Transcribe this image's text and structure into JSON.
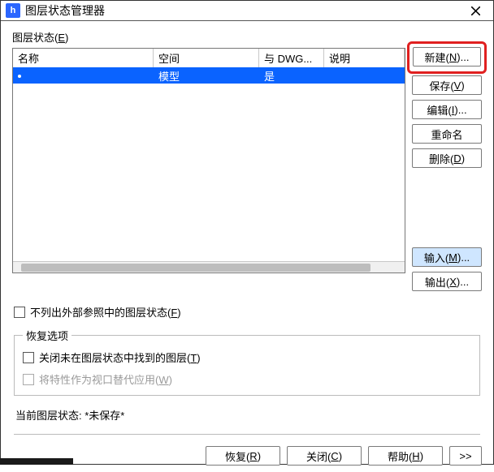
{
  "titlebar": {
    "icon_text": "h",
    "title": "图层状态管理器"
  },
  "states_label": "图层状态(E)",
  "table": {
    "headers": {
      "name": "名称",
      "space": "空间",
      "dwg": "与 DWG...",
      "desc": "说明"
    },
    "rows": [
      {
        "name": "",
        "space": "模型",
        "dwg": "是",
        "desc": "",
        "selected": true
      }
    ]
  },
  "side_buttons": {
    "new": "新建(N)...",
    "save": "保存(V)",
    "edit": "编辑(I)...",
    "rename": "重命名",
    "delete": "删除(D)",
    "import": "输入(M)...",
    "export": "输出(X)..."
  },
  "options": {
    "hide_xref": "不列出外部参照中的图层状态(F)",
    "restore_legend": "恢复选项",
    "close_unfound": "关闭未在图层状态中找到的图层(T)",
    "apply_viewport": "将特性作为视口替代应用(W)"
  },
  "current_state": {
    "label": "当前图层状态: ",
    "value": "*未保存*"
  },
  "bottom": {
    "restore": "恢复(R)",
    "close": "关闭(C)",
    "help": "帮助(H)",
    "more": ">>"
  }
}
